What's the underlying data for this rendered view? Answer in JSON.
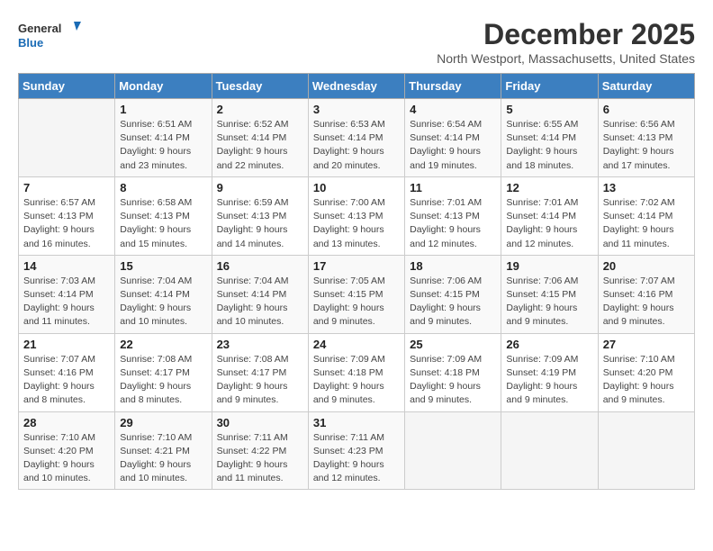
{
  "logo": {
    "general": "General",
    "blue": "Blue"
  },
  "title": "December 2025",
  "location": "North Westport, Massachusetts, United States",
  "days_header": [
    "Sunday",
    "Monday",
    "Tuesday",
    "Wednesday",
    "Thursday",
    "Friday",
    "Saturday"
  ],
  "weeks": [
    [
      {
        "day": "",
        "info": ""
      },
      {
        "day": "1",
        "info": "Sunrise: 6:51 AM\nSunset: 4:14 PM\nDaylight: 9 hours\nand 23 minutes."
      },
      {
        "day": "2",
        "info": "Sunrise: 6:52 AM\nSunset: 4:14 PM\nDaylight: 9 hours\nand 22 minutes."
      },
      {
        "day": "3",
        "info": "Sunrise: 6:53 AM\nSunset: 4:14 PM\nDaylight: 9 hours\nand 20 minutes."
      },
      {
        "day": "4",
        "info": "Sunrise: 6:54 AM\nSunset: 4:14 PM\nDaylight: 9 hours\nand 19 minutes."
      },
      {
        "day": "5",
        "info": "Sunrise: 6:55 AM\nSunset: 4:14 PM\nDaylight: 9 hours\nand 18 minutes."
      },
      {
        "day": "6",
        "info": "Sunrise: 6:56 AM\nSunset: 4:13 PM\nDaylight: 9 hours\nand 17 minutes."
      }
    ],
    [
      {
        "day": "7",
        "info": "Sunrise: 6:57 AM\nSunset: 4:13 PM\nDaylight: 9 hours\nand 16 minutes."
      },
      {
        "day": "8",
        "info": "Sunrise: 6:58 AM\nSunset: 4:13 PM\nDaylight: 9 hours\nand 15 minutes."
      },
      {
        "day": "9",
        "info": "Sunrise: 6:59 AM\nSunset: 4:13 PM\nDaylight: 9 hours\nand 14 minutes."
      },
      {
        "day": "10",
        "info": "Sunrise: 7:00 AM\nSunset: 4:13 PM\nDaylight: 9 hours\nand 13 minutes."
      },
      {
        "day": "11",
        "info": "Sunrise: 7:01 AM\nSunset: 4:13 PM\nDaylight: 9 hours\nand 12 minutes."
      },
      {
        "day": "12",
        "info": "Sunrise: 7:01 AM\nSunset: 4:14 PM\nDaylight: 9 hours\nand 12 minutes."
      },
      {
        "day": "13",
        "info": "Sunrise: 7:02 AM\nSunset: 4:14 PM\nDaylight: 9 hours\nand 11 minutes."
      }
    ],
    [
      {
        "day": "14",
        "info": "Sunrise: 7:03 AM\nSunset: 4:14 PM\nDaylight: 9 hours\nand 11 minutes."
      },
      {
        "day": "15",
        "info": "Sunrise: 7:04 AM\nSunset: 4:14 PM\nDaylight: 9 hours\nand 10 minutes."
      },
      {
        "day": "16",
        "info": "Sunrise: 7:04 AM\nSunset: 4:14 PM\nDaylight: 9 hours\nand 10 minutes."
      },
      {
        "day": "17",
        "info": "Sunrise: 7:05 AM\nSunset: 4:15 PM\nDaylight: 9 hours\nand 9 minutes."
      },
      {
        "day": "18",
        "info": "Sunrise: 7:06 AM\nSunset: 4:15 PM\nDaylight: 9 hours\nand 9 minutes."
      },
      {
        "day": "19",
        "info": "Sunrise: 7:06 AM\nSunset: 4:15 PM\nDaylight: 9 hours\nand 9 minutes."
      },
      {
        "day": "20",
        "info": "Sunrise: 7:07 AM\nSunset: 4:16 PM\nDaylight: 9 hours\nand 9 minutes."
      }
    ],
    [
      {
        "day": "21",
        "info": "Sunrise: 7:07 AM\nSunset: 4:16 PM\nDaylight: 9 hours\nand 8 minutes."
      },
      {
        "day": "22",
        "info": "Sunrise: 7:08 AM\nSunset: 4:17 PM\nDaylight: 9 hours\nand 8 minutes."
      },
      {
        "day": "23",
        "info": "Sunrise: 7:08 AM\nSunset: 4:17 PM\nDaylight: 9 hours\nand 9 minutes."
      },
      {
        "day": "24",
        "info": "Sunrise: 7:09 AM\nSunset: 4:18 PM\nDaylight: 9 hours\nand 9 minutes."
      },
      {
        "day": "25",
        "info": "Sunrise: 7:09 AM\nSunset: 4:18 PM\nDaylight: 9 hours\nand 9 minutes."
      },
      {
        "day": "26",
        "info": "Sunrise: 7:09 AM\nSunset: 4:19 PM\nDaylight: 9 hours\nand 9 minutes."
      },
      {
        "day": "27",
        "info": "Sunrise: 7:10 AM\nSunset: 4:20 PM\nDaylight: 9 hours\nand 9 minutes."
      }
    ],
    [
      {
        "day": "28",
        "info": "Sunrise: 7:10 AM\nSunset: 4:20 PM\nDaylight: 9 hours\nand 10 minutes."
      },
      {
        "day": "29",
        "info": "Sunrise: 7:10 AM\nSunset: 4:21 PM\nDaylight: 9 hours\nand 10 minutes."
      },
      {
        "day": "30",
        "info": "Sunrise: 7:11 AM\nSunset: 4:22 PM\nDaylight: 9 hours\nand 11 minutes."
      },
      {
        "day": "31",
        "info": "Sunrise: 7:11 AM\nSunset: 4:23 PM\nDaylight: 9 hours\nand 12 minutes."
      },
      {
        "day": "",
        "info": ""
      },
      {
        "day": "",
        "info": ""
      },
      {
        "day": "",
        "info": ""
      }
    ]
  ]
}
